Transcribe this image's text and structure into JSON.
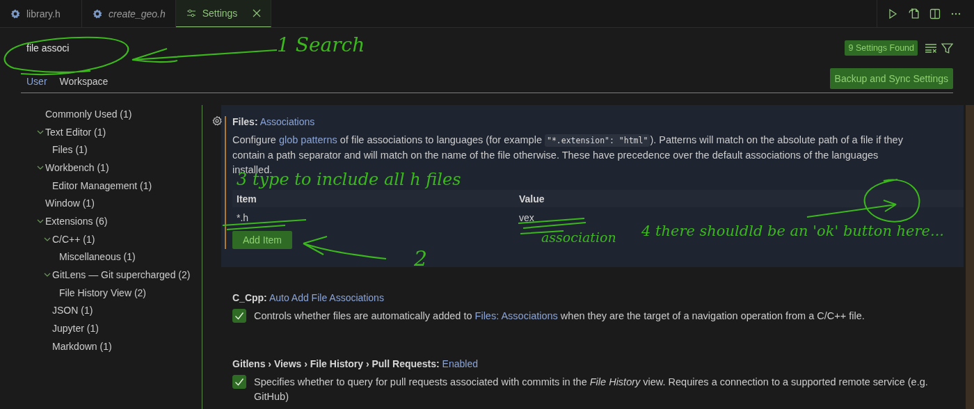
{
  "tabs": [
    {
      "label": "library.h",
      "kind": "file",
      "preview": false,
      "selected": false,
      "closable": false
    },
    {
      "label": "create_geo.h",
      "kind": "file",
      "preview": true,
      "selected": false,
      "closable": false
    },
    {
      "label": "Settings",
      "kind": "settings",
      "preview": false,
      "selected": true,
      "closable": true
    }
  ],
  "search": {
    "value": "file associ"
  },
  "results_badge": "9 Settings Found",
  "sync_button": "Backup and Sync Settings",
  "scope_tabs": [
    {
      "label": "User",
      "selected": true
    },
    {
      "label": "Workspace",
      "selected": false
    }
  ],
  "toc": [
    {
      "label": "Commonly Used (1)"
    },
    {
      "label": "Text Editor (1)",
      "expanded": true,
      "children": [
        {
          "label": "Files (1)"
        }
      ]
    },
    {
      "label": "Workbench (1)",
      "expanded": true,
      "children": [
        {
          "label": "Editor Management (1)"
        }
      ]
    },
    {
      "label": "Window (1)"
    },
    {
      "label": "Extensions (6)",
      "expanded": true,
      "children": [
        {
          "label": "C/C++ (1)",
          "expanded": true,
          "children": [
            {
              "label": "Miscellaneous (1)"
            }
          ]
        },
        {
          "label": "GitLens — Git supercharged (2)",
          "expanded": true,
          "children": [
            {
              "label": "File History View (2)"
            }
          ]
        },
        {
          "label": "JSON (1)"
        },
        {
          "label": "Jupyter (1)"
        },
        {
          "label": "Markdown (1)"
        }
      ]
    }
  ],
  "settings": [
    {
      "kind": "list",
      "focused": true,
      "category": "Files:",
      "name": "Associations",
      "description": [
        {
          "kind": "text",
          "text": "Configure "
        },
        {
          "kind": "link",
          "text": "glob patterns"
        },
        {
          "kind": "text",
          "text": " of file associations to languages (for example "
        },
        {
          "kind": "code",
          "text": "\"*.extension\": \"html\""
        },
        {
          "kind": "text",
          "text": "). Patterns will match on the absolute path of a file if they contain a path separator and will match on the name of the file otherwise. These have precedence over the default associations of the languages installed."
        }
      ],
      "columns": [
        "Item",
        "Value"
      ],
      "rows": [
        [
          "*.h",
          "vex"
        ]
      ],
      "add_button": "Add Item"
    },
    {
      "kind": "checkbox",
      "focused": false,
      "category": "C_Cpp:",
      "name": "Auto Add File Associations",
      "checked": true,
      "description": [
        {
          "kind": "text",
          "text": "Controls whether files are automatically added to "
        },
        {
          "kind": "link",
          "text": "Files: Associations"
        },
        {
          "kind": "text",
          "text": " when they are the target of a navigation operation from a C/C++ file."
        }
      ]
    },
    {
      "kind": "checkbox",
      "focused": false,
      "category": "Gitlens › Views › File History › Pull Requests:",
      "name": "Enabled",
      "checked": true,
      "description": [
        {
          "kind": "text",
          "text": "Specifies whether to query for pull requests associated with commits in the *File History* view. Requires a connection to a supported remote service (e.g. GitHub)"
        }
      ]
    }
  ],
  "annotations": [
    "1 Search",
    "2",
    "3 type to include all h files",
    "association",
    "4 there shouldld be an 'ok' button here..."
  ]
}
